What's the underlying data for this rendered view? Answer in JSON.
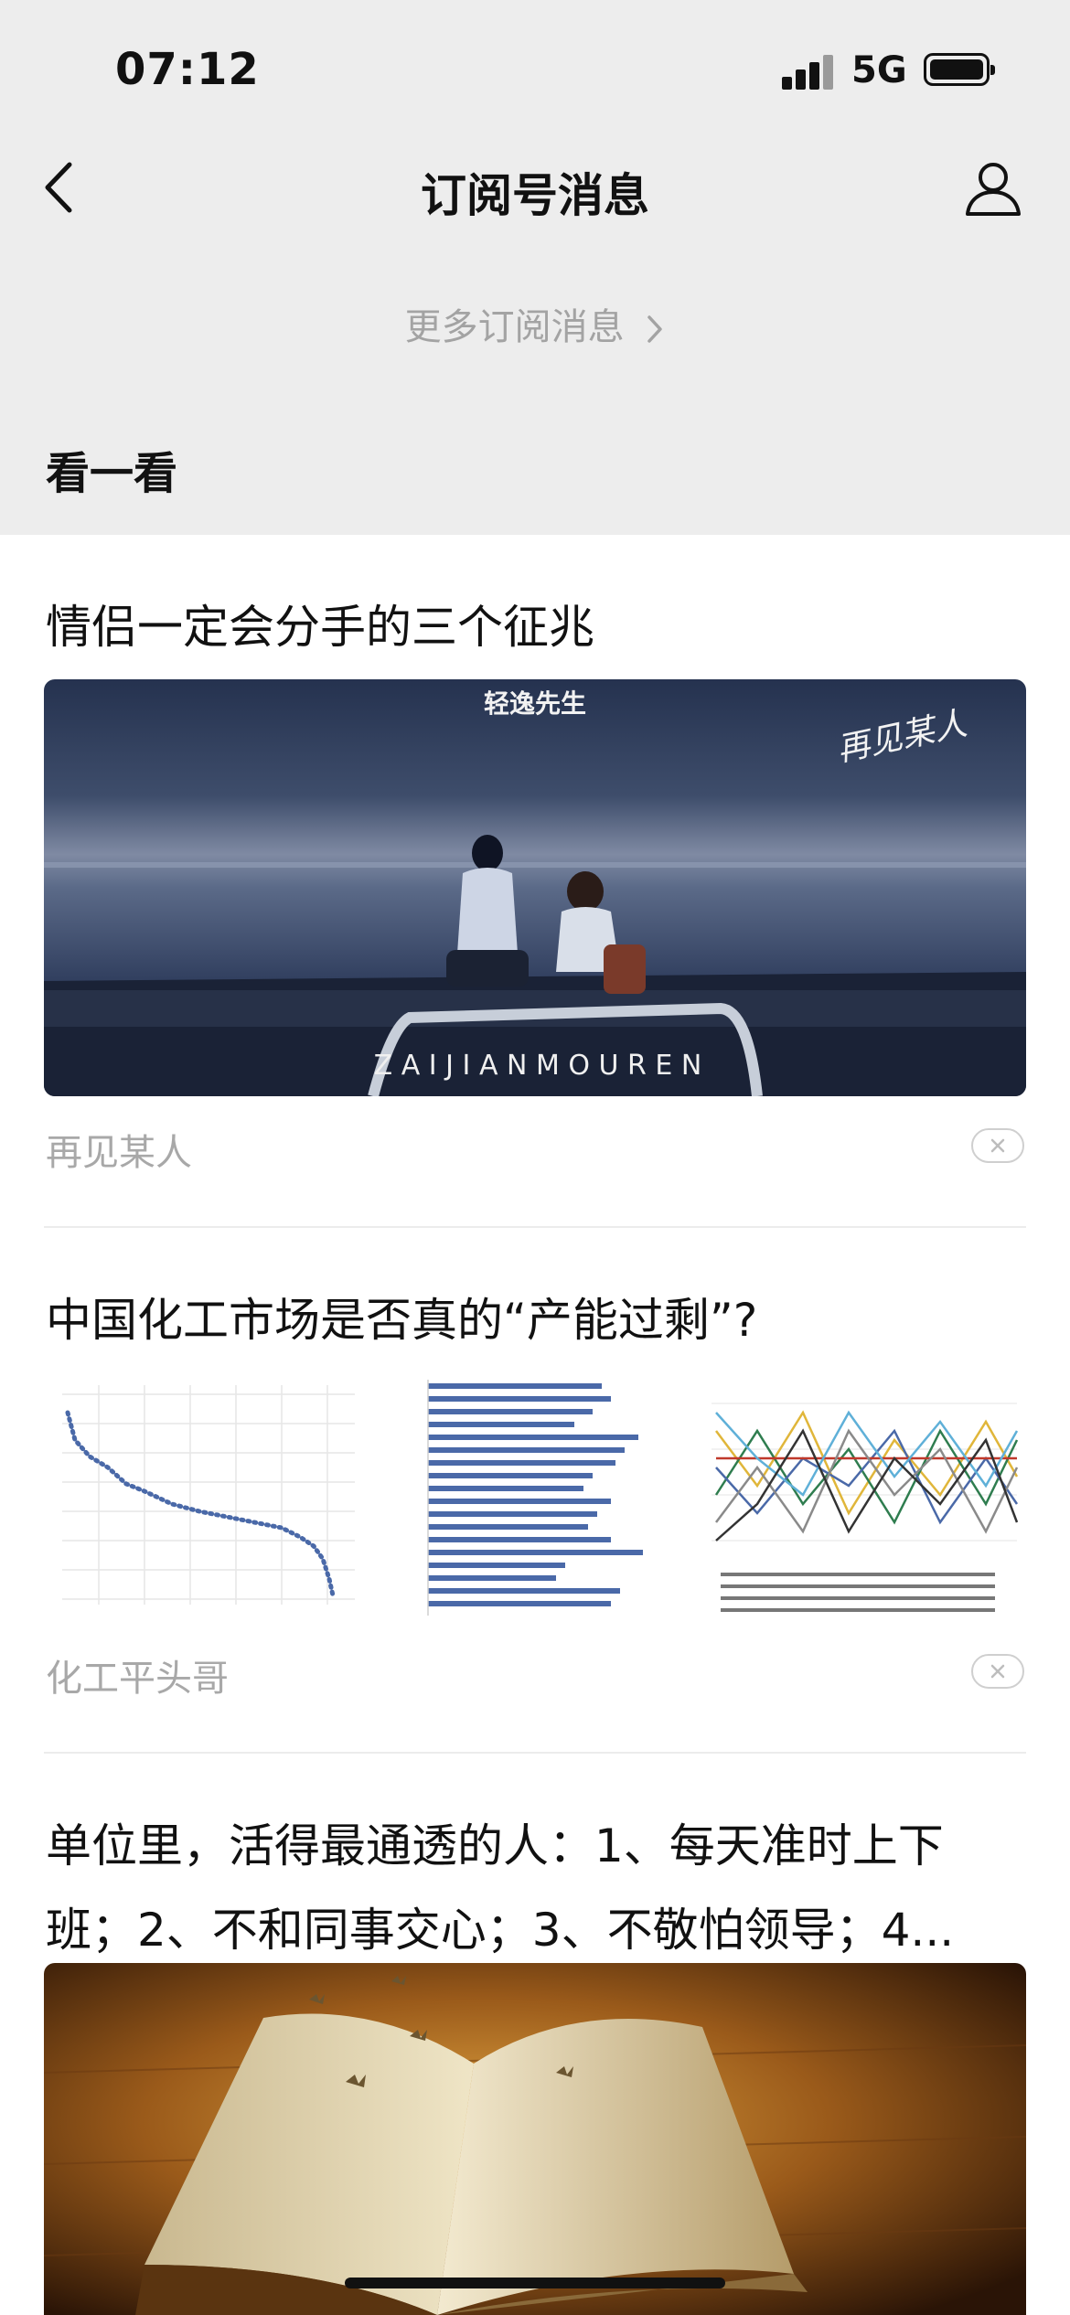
{
  "status_bar": {
    "time": "07:12",
    "network": "5G",
    "signal_icon": "signal-bars-icon",
    "battery_icon": "battery-full-icon"
  },
  "nav": {
    "title": "订阅号消息",
    "back_icon": "chevron-left-icon",
    "profile_icon": "person-icon"
  },
  "more_link": {
    "label": "更多订阅消息",
    "icon": "chevron-right-icon"
  },
  "section": {
    "title": "看一看"
  },
  "articles": [
    {
      "title": "情侣一定会分手的三个征兆",
      "source": "再见某人",
      "image_caption_top": "轻逸先生",
      "image_caption_bottom": "Z A I J I A N M O U R E N",
      "image_signature": "再见某人",
      "dismiss_icon": "close-icon"
    },
    {
      "title": "中国化工市场是否真的“产能过剩”?",
      "source": "化工平头哥",
      "dismiss_icon": "close-icon"
    },
    {
      "title_line1": "单位里，活得最通透的人：1、每天准时上下",
      "title_line2": "班；2、不和同事交心；3、不敬怕领导；4..."
    }
  ],
  "colors": {
    "top_background": "#ededed",
    "secondary_text": "#a8a8a8",
    "bar_blue": "#4a69a8"
  }
}
